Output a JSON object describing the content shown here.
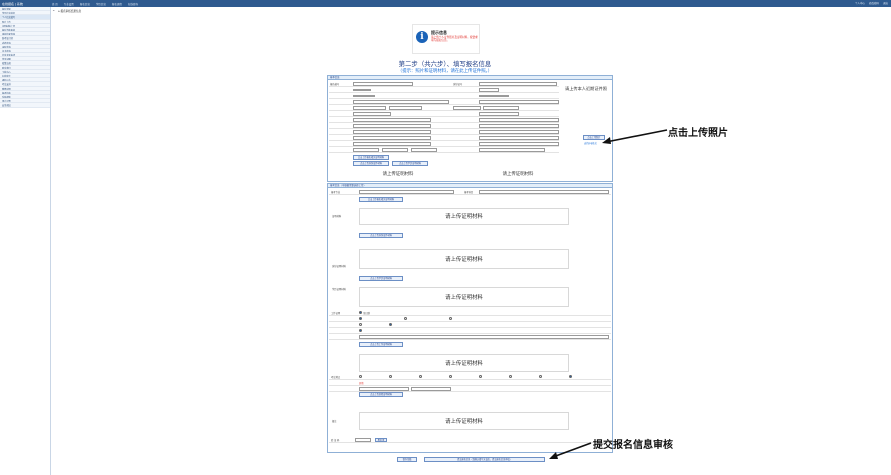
{
  "topbar": {
    "brand": "在线报名 | 系统",
    "menu": [
      "首 页",
      "专业设置",
      "报名信息",
      "学历信息",
      "报名流程",
      "在线咨询"
    ],
    "right": [
      "个人中心",
      "修改密码",
      "退出"
    ]
  },
  "sidebar": {
    "items": [
      "报名须知",
      "学历信息核实",
      "个人信息填写",
      "照片上传",
      "证明材料上传",
      "报名资格审核",
      "审核结果查询",
      "准考证打印",
      "成绩查询",
      "录取查询",
      "证书查询",
      "信息变更申请",
      "常见问题",
      "政策法规",
      "联系我们",
      "下载中心",
      "在线留言",
      "通知公告",
      "考试安排",
      "缴费说明",
      "报考指南",
      "系统帮助",
      "用户设置",
      "安全退出"
    ],
    "active_index": 2
  },
  "breadcrumb": "报名审核结果信息",
  "notice": {
    "title": "提示信息",
    "text": "请上传个人证件照片及证明材料，按要求填写报名信息。"
  },
  "step": {
    "title": "第二步（共六步）、填写报名信息",
    "hint": "（提示：照片和证明材料，请在此上传证件照。）"
  },
  "basic": {
    "header": "基本信息",
    "fields": [
      {
        "label": "报名编号",
        "value": "",
        "label2": "身份证号",
        "value2": "",
        "label3": "",
        "value3": ""
      }
    ],
    "photo_placeholder": "请上传本人近期证件照",
    "upload_photo_button": "点击上传照片",
    "upload_hint": "支持jpg格式",
    "material_text_1": "请上传证明材料",
    "material_text_2": "请上传证明材料"
  },
  "section2": {
    "header": "报考信息（可根据需要选择上传）",
    "upload_btn_1": "点击上传报名相关证明材料",
    "upload_btn_2": "点击上传身份证件材料",
    "upload_btn_3": "点击上传学历证明材料",
    "upload_btn_4": "点击上传其他证明材料",
    "upload_btn_5": "点击上传工作证明材料",
    "upload_placeholder": "请上传证明材料",
    "labels": [
      "证明材料",
      "身份证明材料",
      "学历证明材料",
      "工作证明",
      "报考专业",
      "报考科目",
      "考试地点",
      "备注"
    ],
    "options": [
      "全日制",
      "非全日制",
      "其他"
    ]
  },
  "footer": {
    "captcha_label": "验 证 码",
    "captcha_button": "看不清",
    "save_button": "保存草稿",
    "submit_button": "提交报名信息（请确认填写无误后，提交报名信息审核）"
  },
  "annotations": {
    "upload_photo": "点击上传照片",
    "submit_review": "提交报名信息审核"
  }
}
